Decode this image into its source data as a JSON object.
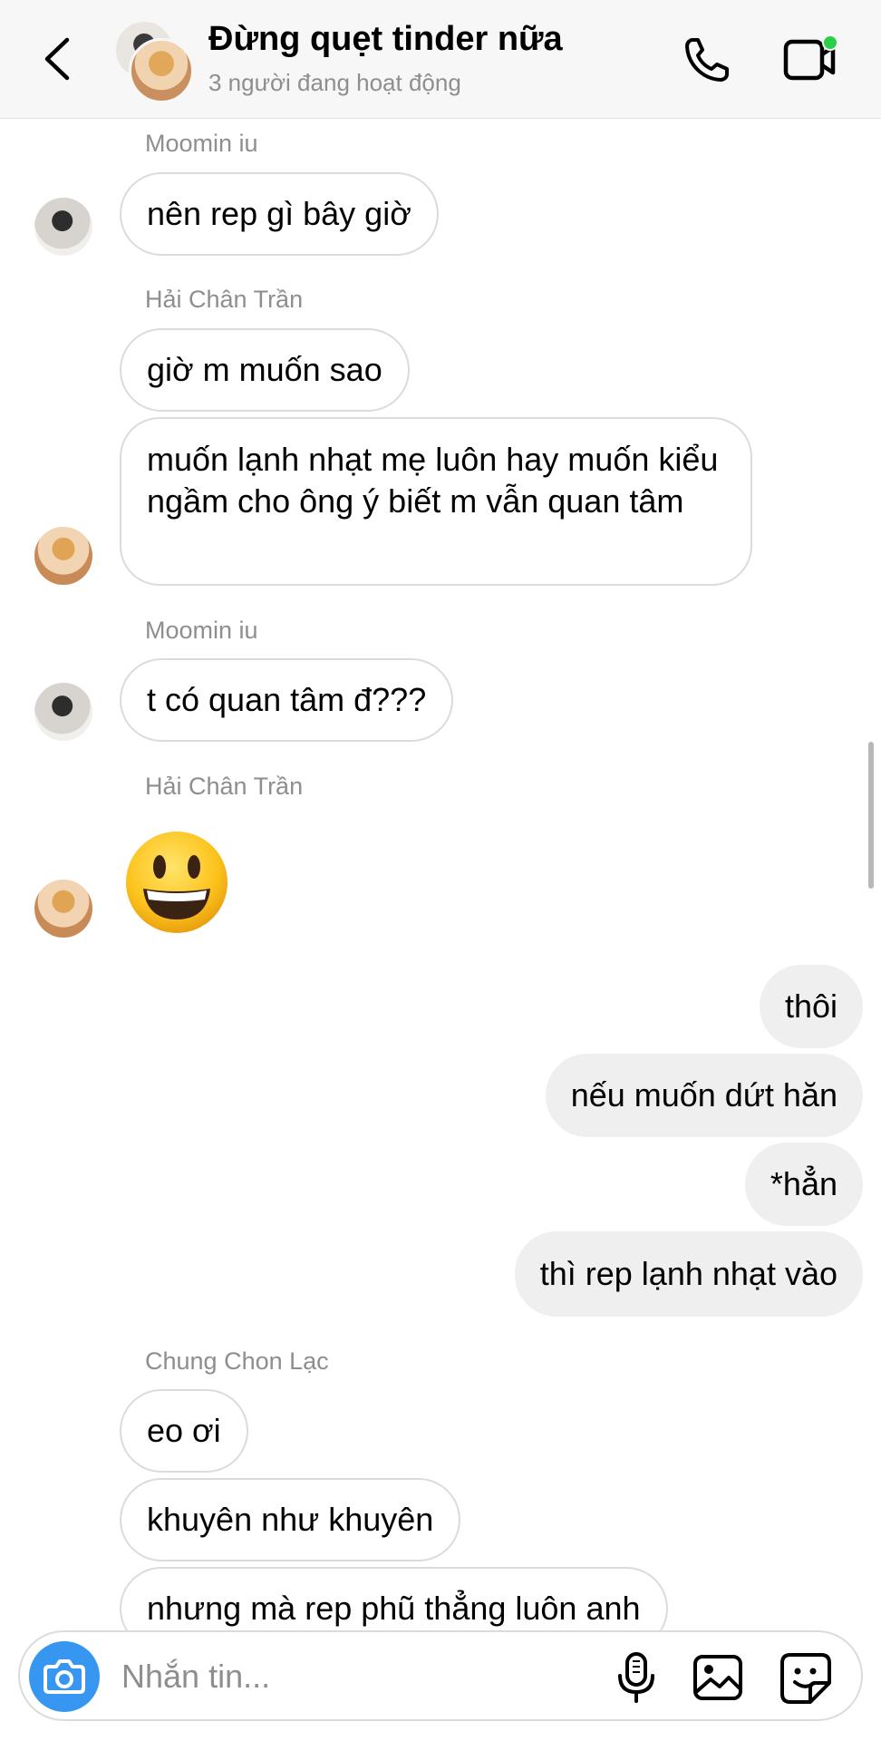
{
  "header": {
    "title": "Đừng quẹt tinder nữa",
    "subtitle": "3 người đang hoạt động",
    "icons": {
      "back": "chevron-left-icon",
      "call": "phone-icon",
      "video": "video-camera-icon"
    },
    "online_color": "#2bd04a"
  },
  "messages": {
    "s1": "Moomin iu",
    "m1": "nên rep gì bây giờ",
    "s2": "Hải Chân Trần",
    "m2": "giờ m muốn sao",
    "m3": "muốn lạnh nhạt mẹ luôn hay muốn kiểu ngầm cho ông ý biết m vẫn quan tâm",
    "s3": "Moomin iu",
    "m4": "t có quan tâm đ???",
    "s4": "Hải Chân Trần",
    "m5_emoji": "grinning-face-emoji",
    "o1": "thôi",
    "o2": "nếu muốn dứt hăn",
    "o3": "*hẳn",
    "o4": "thì rep lạnh nhạt vào",
    "s5": "Chung Chon Lạc",
    "m6": "eo ơi",
    "m7": "khuyên như khuyên",
    "m8": "nhưng mà rep phũ thẳng luôn anh"
  },
  "composer": {
    "placeholder": "Nhắn tin...",
    "icons": {
      "camera": "camera-icon",
      "mic": "microphone-icon",
      "gallery": "image-icon",
      "sticker": "sticker-icon"
    },
    "camera_color": "#3797f0"
  }
}
